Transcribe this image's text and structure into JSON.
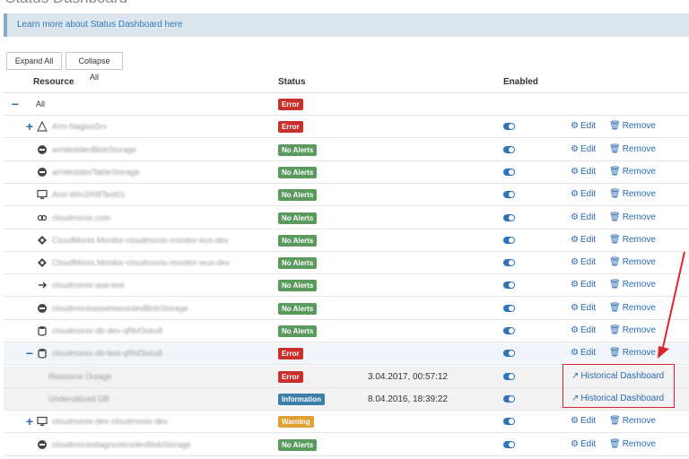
{
  "page": {
    "title": "Status Dashboard"
  },
  "info": {
    "link_text": "Learn more about Status Dashboard here"
  },
  "toolbar": {
    "expand_label": "Expand All",
    "collapse_label": "Collapse All"
  },
  "columns": {
    "resource": "Resource",
    "status": "Status",
    "enabled": "Enabled"
  },
  "actions": {
    "edit": "Edit",
    "remove": "Remove",
    "historical": "Historical Dashboard"
  },
  "colors": {
    "error": "#c9302c",
    "ok": "#5b9a5d",
    "warning": "#e0a034",
    "info": "#3e7faa",
    "link": "#2a6bb5",
    "highlight": "#d9262c"
  },
  "rows": [
    {
      "toggle": "−",
      "icon": "",
      "name": "All",
      "status": "Error",
      "level": "error",
      "enabled": false,
      "actions": false
    },
    {
      "toggle": "+",
      "icon": "warning-icon",
      "name": "Arm-NagiosSrv",
      "status": "Error",
      "level": "error",
      "enabled": true,
      "actions": true
    },
    {
      "toggle": "",
      "icon": "storage-icon",
      "name": "armtestdevBlobStorage",
      "status": "No Alerts",
      "level": "ok",
      "enabled": true,
      "actions": true
    },
    {
      "toggle": "",
      "icon": "storage-icon",
      "name": "armtestdevTableStorage",
      "status": "No Alerts",
      "level": "ok",
      "enabled": true,
      "actions": true
    },
    {
      "toggle": "",
      "icon": "vm-icon",
      "name": "Arm-Win2008Test01",
      "status": "No Alerts",
      "level": "ok",
      "enabled": true,
      "actions": true
    },
    {
      "toggle": "",
      "icon": "link-icon",
      "name": "cloudmonix.com",
      "status": "No Alerts",
      "level": "ok",
      "enabled": true,
      "actions": true
    },
    {
      "toggle": "",
      "icon": "cloud-service-icon",
      "name": "CloudMonix.Monitor-cloudmonix-monitor-eus-dev",
      "status": "No Alerts",
      "level": "ok",
      "enabled": true,
      "actions": true
    },
    {
      "toggle": "",
      "icon": "cloud-service-icon",
      "name": "CloudMonix.Monitor-cloudmonix-monitor-wus-dev",
      "status": "No Alerts",
      "level": "ok",
      "enabled": true,
      "actions": true
    },
    {
      "toggle": "",
      "icon": "plug-icon",
      "name": "cloudmonix-asa-test",
      "status": "No Alerts",
      "level": "ok",
      "enabled": true,
      "actions": true
    },
    {
      "toggle": "",
      "icon": "storage-icon",
      "name": "cloudmonixassetswusdevBlobStorage",
      "status": "No Alerts",
      "level": "ok",
      "enabled": true,
      "actions": true
    },
    {
      "toggle": "",
      "icon": "database-icon",
      "name": "cloudmonix-db-dev-qf9sf3xeu8",
      "status": "No Alerts",
      "level": "ok",
      "enabled": true,
      "actions": true
    },
    {
      "toggle": "−",
      "icon": "database-icon",
      "name": "cloudmonix-db-test-qf9sf3xeu8",
      "status": "Error",
      "level": "error",
      "enabled": true,
      "actions": true,
      "selected": true
    },
    {
      "toggle": "",
      "icon": "",
      "name": "Resource Outage",
      "status": "Error",
      "level": "error",
      "timestamp": "3.04.2017, 00:57:12",
      "enabled": true,
      "actions": false,
      "historical": true,
      "sub": true
    },
    {
      "toggle": "",
      "icon": "",
      "name": "Underutilized DB",
      "status": "Information",
      "level": "info",
      "timestamp": "8.04.2016, 18:39:22",
      "enabled": true,
      "actions": false,
      "historical": true,
      "sub": true
    },
    {
      "toggle": "+",
      "icon": "vm-icon",
      "name": "cloudmonix-dev-cloudmonix-dev",
      "status": "Warning",
      "level": "warn",
      "enabled": true,
      "actions": true
    },
    {
      "toggle": "",
      "icon": "storage-icon",
      "name": "cloudmonixdiagnosticsdevBlobStorage",
      "status": "No Alerts",
      "level": "ok",
      "enabled": true,
      "actions": true
    }
  ]
}
